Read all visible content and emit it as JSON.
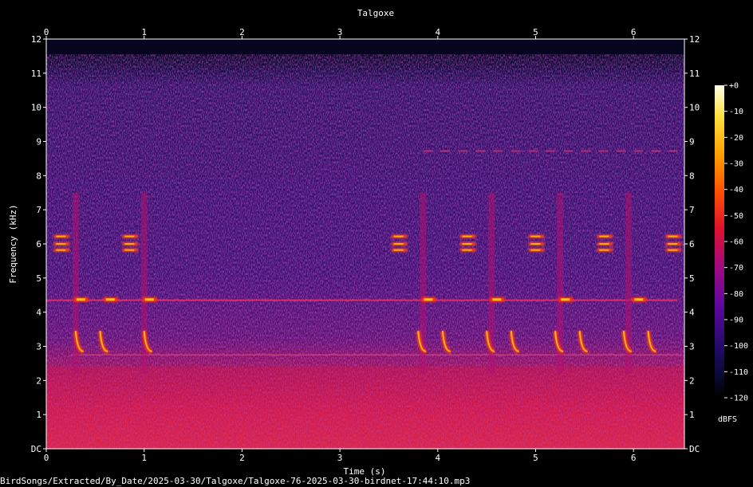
{
  "colors": {
    "background": "#000000",
    "text": "#ffffff",
    "noise_floor": "#2a1060",
    "low_band": "#c01050",
    "call_core": "#ffb000",
    "colormap": [
      "#000000",
      "#0a0a3a",
      "#3a0a80",
      "#8a0a90",
      "#d01050",
      "#ff3000",
      "#ff8c00",
      "#ffd000",
      "#ffffe0"
    ]
  },
  "chart_data": {
    "type": "heatmap",
    "title": "Talgoxe",
    "xlabel": "Time (s)",
    "ylabel": "Frequency (kHz)",
    "x_range": [
      0,
      6.52
    ],
    "y_range": [
      0,
      12
    ],
    "x_ticks": [
      0,
      1,
      2,
      3,
      4,
      5,
      6
    ],
    "x_tick_labels": [
      "0",
      "1",
      "2",
      "3",
      "4",
      "5",
      "6"
    ],
    "y_ticks": [
      0,
      1,
      2,
      3,
      4,
      5,
      6,
      7,
      8,
      9,
      10,
      11,
      12
    ],
    "y_tick_labels": [
      "DC",
      "1",
      "2",
      "3",
      "4",
      "5",
      "6",
      "7",
      "8",
      "9",
      "10",
      "11",
      "12"
    ],
    "colorbar": {
      "label": "dBFS",
      "range": [
        -120,
        0
      ],
      "ticks": [
        0,
        -10,
        -20,
        -30,
        -40,
        -50,
        -60,
        -70,
        -80,
        -90,
        -100,
        -110,
        -120
      ],
      "tick_labels": [
        "+0",
        "-10",
        "-20",
        "-30",
        "-40",
        "-50",
        "-60",
        "-70",
        "-80",
        "-90",
        "-100",
        "-110",
        "-120"
      ]
    },
    "signal_ceiling_khz": 11.55,
    "low_band_khz": [
      0,
      2.4
    ],
    "calls": {
      "note_times_s": [
        0.3,
        1.0,
        3.85,
        4.55,
        5.25,
        5.95
      ],
      "freq_6k_times_s": [
        0.15,
        0.85,
        3.6,
        4.3,
        5.0,
        5.7,
        6.4
      ],
      "tone_4_35k_times_s": [
        0.35,
        0.65,
        1.05,
        3.9,
        4.6,
        5.3,
        6.05
      ],
      "sweep_3k_times_s": [
        0.3,
        0.55,
        1.0,
        3.8,
        4.05,
        4.5,
        4.75,
        5.2,
        5.45,
        5.9,
        6.15
      ],
      "steady_4_35k_span_s": [
        0,
        6.45
      ],
      "steady_2_75k_span_s": [
        0.25,
        6.5
      ],
      "steady_8_7k_span_s": [
        3.85,
        6.45
      ]
    }
  },
  "footer": {
    "file_path": "BirdSongs/Extracted/By_Date/2025-03-30/Talgoxe/Talgoxe-76-2025-03-30-birdnet-17:44:10.mp3"
  }
}
